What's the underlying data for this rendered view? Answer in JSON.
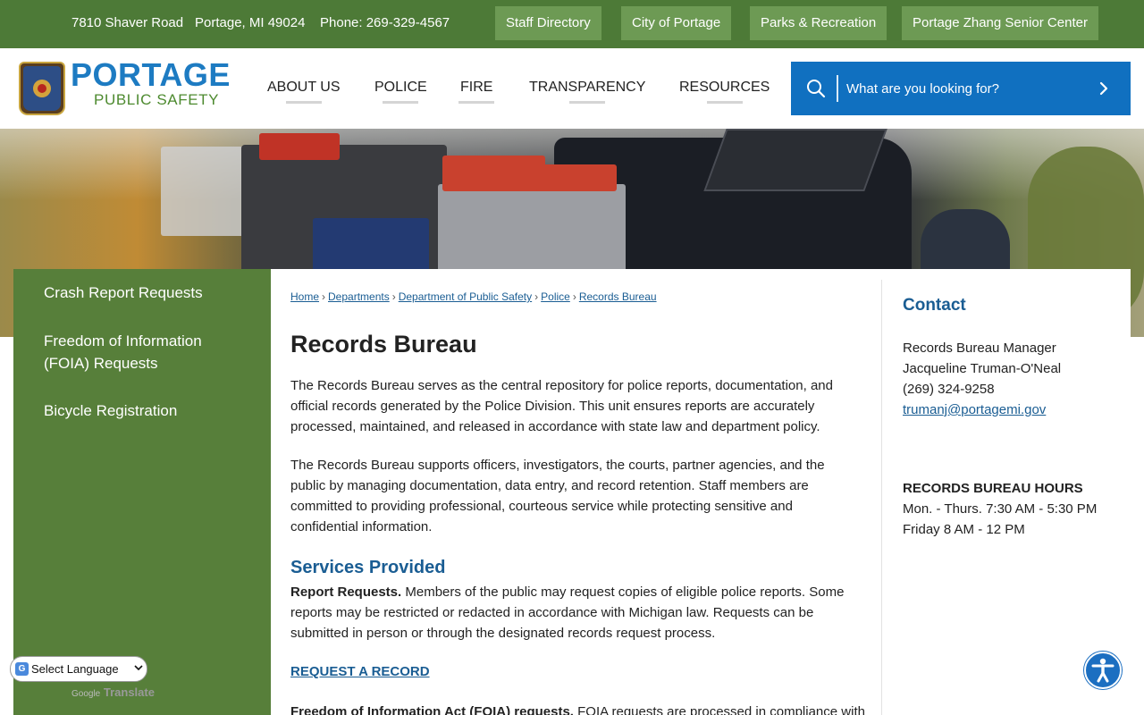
{
  "topbar": {
    "address": "7810 Shaver Road",
    "city": "Portage, MI 49024",
    "phone": "Phone: 269-329-4567",
    "links": [
      "Staff Directory",
      "City of Portage",
      "Parks & Recreation",
      "Portage Zhang Senior Center"
    ]
  },
  "logo": {
    "word": "PORTAGE",
    "sub": "PUBLIC SAFETY",
    "colors": {
      "word": "#1d7bc2",
      "sub": "#4d8a2f"
    }
  },
  "nav": {
    "items": [
      "ABOUT US",
      "POLICE",
      "FIRE",
      "TRANSPARENCY",
      "RESOURCES"
    ]
  },
  "search": {
    "placeholder": "What are you looking for?",
    "icon": "search-icon",
    "go_icon": "chevron-right-icon"
  },
  "sidenav": {
    "items": [
      "Crash Report Requests",
      "Freedom of Information (FOIA) Requests",
      "Bicycle Registration"
    ]
  },
  "breadcrumb": {
    "items": [
      "Home",
      "Departments",
      "Department of Public Safety",
      "Police",
      "Records Bureau"
    ],
    "separator": "›"
  },
  "main": {
    "title": "Records Bureau",
    "para1": "The Records Bureau serves as the central repository for police reports, documentation, and official records generated by the Police Division. This unit ensures reports are accurately processed, maintained, and released in accordance with state law and department policy.",
    "para2": "The Records Bureau supports officers, investigators, the courts, partner agencies, and the public by managing documentation, data entry, and record retention. Staff members are committed to providing professional, courteous service while protecting sensitive and confidential information.",
    "services_heading": "Services Provided",
    "report_label": "Report Requests.",
    "report_text": " Members of the public may request copies of eligible police reports. Some reports may be restricted or redacted in accordance with Michigan law. Requests can be submitted in person or through the designated records request process.",
    "request_link": "REQUEST A RECORD",
    "foia_label": "Freedom of Information Act (FOIA) requests.",
    "foia_text": " FOIA requests are processed in compliance with"
  },
  "contact": {
    "heading": "Contact",
    "role": "Records Bureau Manager",
    "name": "Jacqueline Truman-O'Neal",
    "phone": "(269) 324-9258",
    "email": "trumanj@portagemi.gov",
    "hours_heading": "RECORDS BUREAU HOURS",
    "hours_1": "Mon. - Thurs. 7:30 AM - 5:30 PM",
    "hours_2": "Friday 8 AM - 12 PM"
  },
  "translate": {
    "select_label": "Select Language",
    "powered_google": "Google",
    "powered_translate": "Translate"
  },
  "colors": {
    "topbar": "#4d7a37",
    "topbar_button": "#6d9a54",
    "sidenav": "#577f3a",
    "search": "#1070c0",
    "link": "#1a5d93"
  }
}
